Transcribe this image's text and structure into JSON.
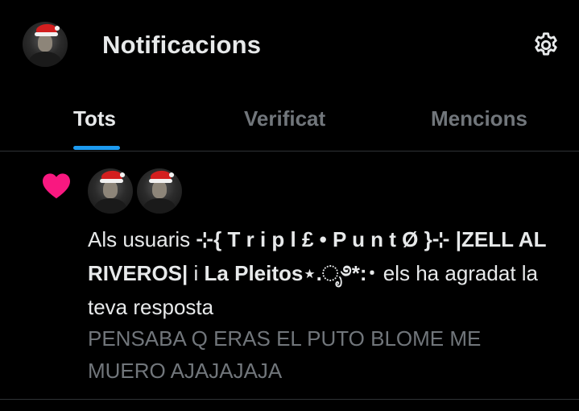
{
  "header": {
    "title": "Notificacions",
    "settings_icon": "gear-icon"
  },
  "tabs": [
    {
      "label": "Tots",
      "active": true
    },
    {
      "label": "Verificat",
      "active": false
    },
    {
      "label": "Mencions",
      "active": false
    }
  ],
  "notification": {
    "icon": "heart-icon",
    "icon_color": "#f91880",
    "prefix": "Als usuaris ",
    "user1": "⊹{ T r i p l £ • P u n t Ø }⊹",
    "user2": "|ZELL AL RIVEROS|",
    "connector": " i ",
    "user3": "La Pleitos⋆.ೃ࿔*:･",
    "suffix": " els ha agradat la teva resposta",
    "reply_line1": "PENSABA Q ERAS EL PUTO BLOME ME",
    "reply_line2": "MUERO AJAJAJAJA"
  },
  "colors": {
    "background": "#000000",
    "text": "#e7e9ea",
    "muted": "#71767b",
    "accent": "#1d9bf0",
    "like": "#f91880",
    "divider": "#2f3336"
  }
}
